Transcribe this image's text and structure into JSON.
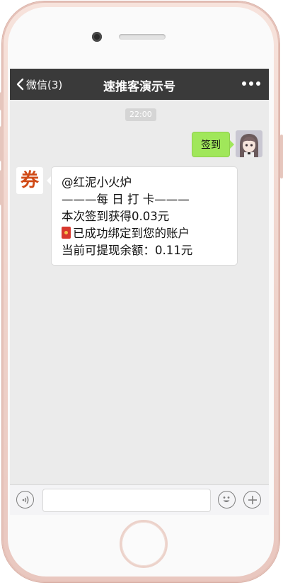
{
  "navbar": {
    "back_label": "微信(3)",
    "title": "速推客演示号"
  },
  "chat": {
    "timestamp": "22:00",
    "outgoing_message": "签到",
    "bot_avatar_glyph": "券",
    "incoming_lines": [
      "@红泥小火炉",
      "———每 日 打 卡———",
      "本次签到获得0.03元",
      "已成功绑定到您的账户",
      "当前可提现余额：0.11元"
    ]
  },
  "icons": {
    "back": "chevron-left-icon",
    "more": "more-dots-icon",
    "voice": "voice-icon",
    "emoji": "emoji-icon",
    "plus": "plus-icon",
    "red_packet": "red-envelope-icon"
  },
  "colors": {
    "navbar": "#3a3a3a",
    "chat_background": "#ebebeb",
    "outgoing_bubble": "#a0e75a",
    "bot_avatar": "#d04a16",
    "phone_shell": "#efd3cb"
  }
}
